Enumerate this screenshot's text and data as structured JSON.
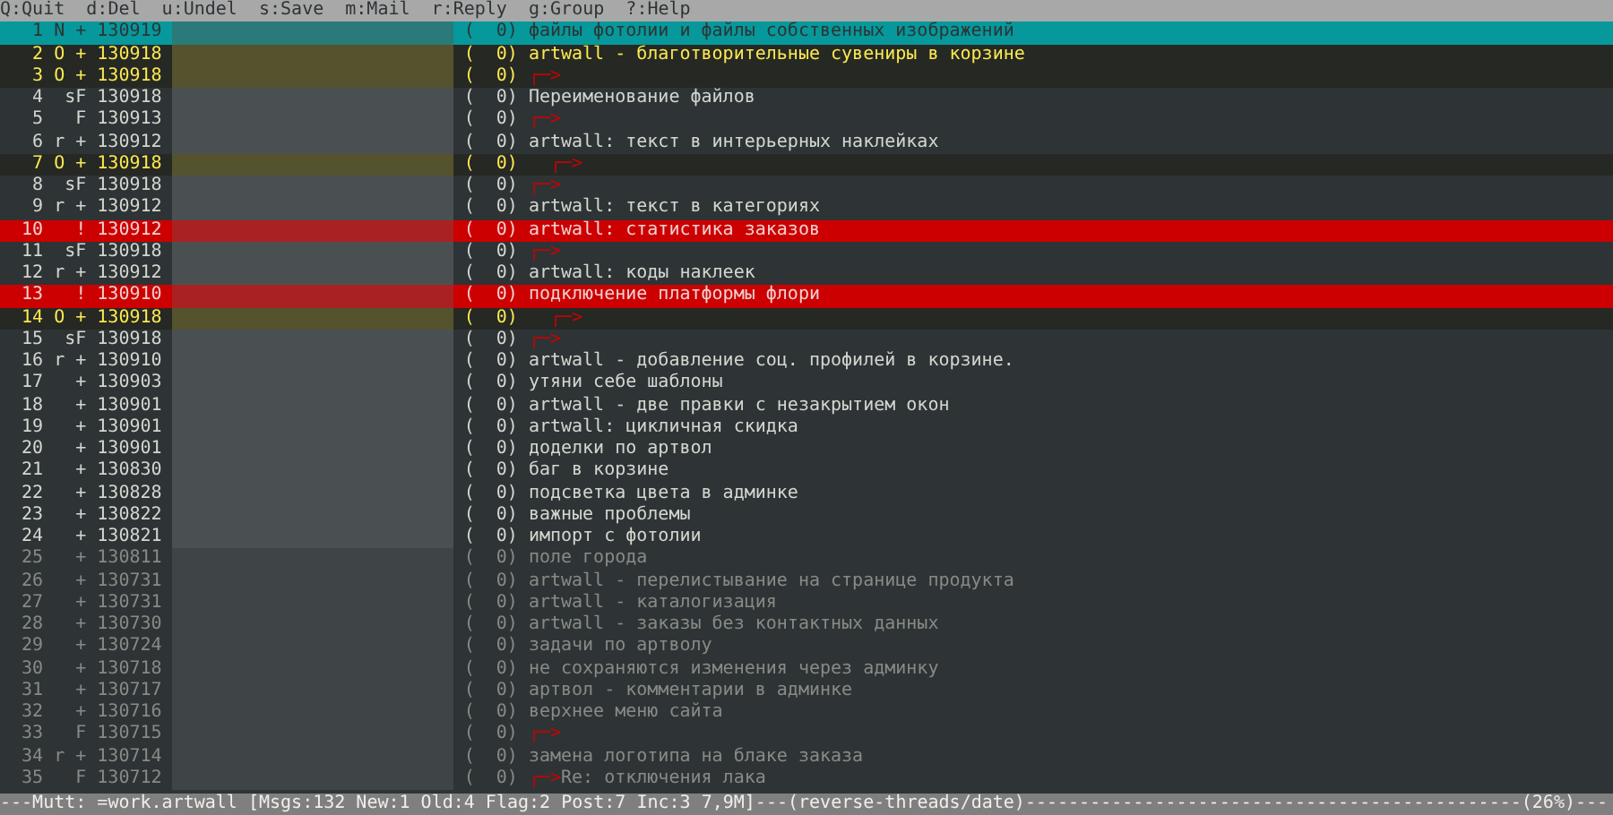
{
  "help_bar": [
    "Q:Quit",
    "d:Del",
    "u:Undel",
    "s:Save",
    "m:Mail",
    "r:Reply",
    "g:Group",
    "?:Help"
  ],
  "rows": [
    {
      "num": "1",
      "flags": "N +",
      "date": "130919",
      "size": "(  0)",
      "subject": "файлы фотолии и файлы собственных изображений",
      "kind": "new",
      "selected": true
    },
    {
      "num": "2",
      "flags": "O +",
      "date": "130918",
      "size": "(  0)",
      "subject": "artwall - благотворительные сувениры в корзине",
      "kind": "old",
      "selected": false
    },
    {
      "num": "3",
      "flags": "O +",
      "date": "130918",
      "size": "(  0)",
      "arrow": "┌─>",
      "kind": "old",
      "selected": false
    },
    {
      "num": "4",
      "flags": "sF",
      "date": "130918",
      "size": "(  0)",
      "subject": "Переименование файлов",
      "kind": "normal",
      "selected": false
    },
    {
      "num": "5",
      "flags": "F",
      "date": "130913",
      "size": "(  0)",
      "arrow": "┌─>",
      "kind": "normal",
      "selected": false
    },
    {
      "num": "6",
      "flags": "r +",
      "date": "130912",
      "size": "(  0)",
      "subject": "artwall: текст в интерьерных наклейках",
      "kind": "normal",
      "selected": false
    },
    {
      "num": "7",
      "flags": "O +",
      "date": "130918",
      "size": "(  0)",
      "arrow": "  ┌─>",
      "kind": "old",
      "selected": false
    },
    {
      "num": "8",
      "flags": "sF",
      "date": "130918",
      "size": "(  0)",
      "arrow": "┌─>",
      "kind": "normal",
      "selected": false
    },
    {
      "num": "9",
      "flags": "r +",
      "date": "130912",
      "size": "(  0)",
      "subject": "artwall: текст в категориях",
      "kind": "normal",
      "selected": false
    },
    {
      "num": "10",
      "flags": "!",
      "date": "130912",
      "size": "(  0)",
      "subject": "artwall: статистика заказов",
      "kind": "flagged",
      "selected": false
    },
    {
      "num": "11",
      "flags": "sF",
      "date": "130918",
      "size": "(  0)",
      "arrow": "┌─>",
      "kind": "normal",
      "selected": false
    },
    {
      "num": "12",
      "flags": "r +",
      "date": "130912",
      "size": "(  0)",
      "subject": "artwall: коды наклеек",
      "kind": "normal",
      "selected": false
    },
    {
      "num": "13",
      "flags": "!",
      "date": "130910",
      "size": "(  0)",
      "subject": "подключение платформы флори",
      "kind": "flagged",
      "selected": false
    },
    {
      "num": "14",
      "flags": "O +",
      "date": "130918",
      "size": "(  0)",
      "arrow": "  ┌─>",
      "kind": "old",
      "selected": false
    },
    {
      "num": "15",
      "flags": "sF",
      "date": "130918",
      "size": "(  0)",
      "arrow": "┌─>",
      "kind": "normal",
      "selected": false
    },
    {
      "num": "16",
      "flags": "r +",
      "date": "130910",
      "size": "(  0)",
      "subject": "artwall - добавление соц. профилей в корзине.",
      "kind": "normal",
      "selected": false
    },
    {
      "num": "17",
      "flags": "+",
      "date": "130903",
      "size": "(  0)",
      "subject": "утяни себе шаблоны",
      "kind": "normal",
      "selected": false
    },
    {
      "num": "18",
      "flags": "+",
      "date": "130901",
      "size": "(  0)",
      "subject": "artwall - две правки с незакрытием окон",
      "kind": "normal",
      "selected": false
    },
    {
      "num": "19",
      "flags": "+",
      "date": "130901",
      "size": "(  0)",
      "subject": "artwall: цикличная скидка",
      "kind": "normal",
      "selected": false
    },
    {
      "num": "20",
      "flags": "+",
      "date": "130901",
      "size": "(  0)",
      "subject": "доделки по артвол",
      "kind": "normal",
      "selected": false
    },
    {
      "num": "21",
      "flags": "+",
      "date": "130830",
      "size": "(  0)",
      "subject": "баг в корзине",
      "kind": "normal",
      "selected": false
    },
    {
      "num": "22",
      "flags": "+",
      "date": "130828",
      "size": "(  0)",
      "subject": "подсветка цвета в админке",
      "kind": "normal",
      "selected": false
    },
    {
      "num": "23",
      "flags": "+",
      "date": "130822",
      "size": "(  0)",
      "subject": "важные проблемы",
      "kind": "normal",
      "selected": false
    },
    {
      "num": "24",
      "flags": "+",
      "date": "130821",
      "size": "(  0)",
      "subject": "импорт с фотолии",
      "kind": "normal",
      "selected": false
    },
    {
      "num": "25",
      "flags": "+",
      "date": "130811",
      "size": "(  0)",
      "subject": "поле города",
      "kind": "read",
      "selected": false
    },
    {
      "num": "26",
      "flags": "+",
      "date": "130731",
      "size": "(  0)",
      "subject": "artwall - перелистывание на странице продукта",
      "kind": "read",
      "selected": false
    },
    {
      "num": "27",
      "flags": "+",
      "date": "130731",
      "size": "(  0)",
      "subject": "artwall - каталогизация",
      "kind": "read",
      "selected": false
    },
    {
      "num": "28",
      "flags": "+",
      "date": "130730",
      "size": "(  0)",
      "subject": "artwall - заказы без контактных данных",
      "kind": "read",
      "selected": false
    },
    {
      "num": "29",
      "flags": "+",
      "date": "130724",
      "size": "(  0)",
      "subject": "задачи по артволу",
      "kind": "read",
      "selected": false
    },
    {
      "num": "30",
      "flags": "+",
      "date": "130718",
      "size": "(  0)",
      "subject": "не сохраняются изменения через админку",
      "kind": "read",
      "selected": false
    },
    {
      "num": "31",
      "flags": "+",
      "date": "130717",
      "size": "(  0)",
      "subject": "артвол - комментарии в админке",
      "kind": "read",
      "selected": false
    },
    {
      "num": "32",
      "flags": "+",
      "date": "130716",
      "size": "(  0)",
      "subject": "верхнее меню сайта",
      "kind": "read",
      "selected": false
    },
    {
      "num": "33",
      "flags": "F",
      "date": "130715",
      "size": "(  0)",
      "arrow": "┌─>",
      "kind": "read",
      "selected": false
    },
    {
      "num": "34",
      "flags": "r +",
      "date": "130714",
      "size": "(  0)",
      "subject": "замена логотипа на блаке заказа",
      "kind": "read",
      "selected": false
    },
    {
      "num": "35",
      "flags": "F",
      "date": "130712",
      "size": "(  0)",
      "arrow": "┌─>",
      "subject": "Re: отключения лака",
      "kind": "read",
      "selected": false
    }
  ],
  "status_bar": "---Mutt: =work.artwall [Msgs:132 New:1 Old:4 Flag:2 Post:7 Inc:3 7,9M]---(reverse-threads/date)----------------------------------------------(26%)---"
}
